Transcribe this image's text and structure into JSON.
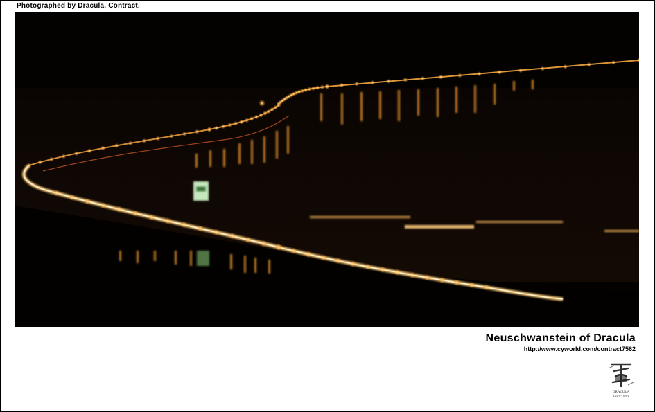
{
  "credit": "Photographed by Dracula, Contract.",
  "photo": {
    "subject": "night-highway-bridge-photo"
  },
  "caption": {
    "title": "Neuschwanstein of Dracula",
    "url": "http://www.cyworld.com/contract7562"
  },
  "logo": {
    "text_top": "DRACULA",
    "text_bottom": "ASSOCIATES"
  },
  "colors": {
    "frame": "#000000",
    "light": "#ffcf7a",
    "road": "#f7b24a"
  }
}
